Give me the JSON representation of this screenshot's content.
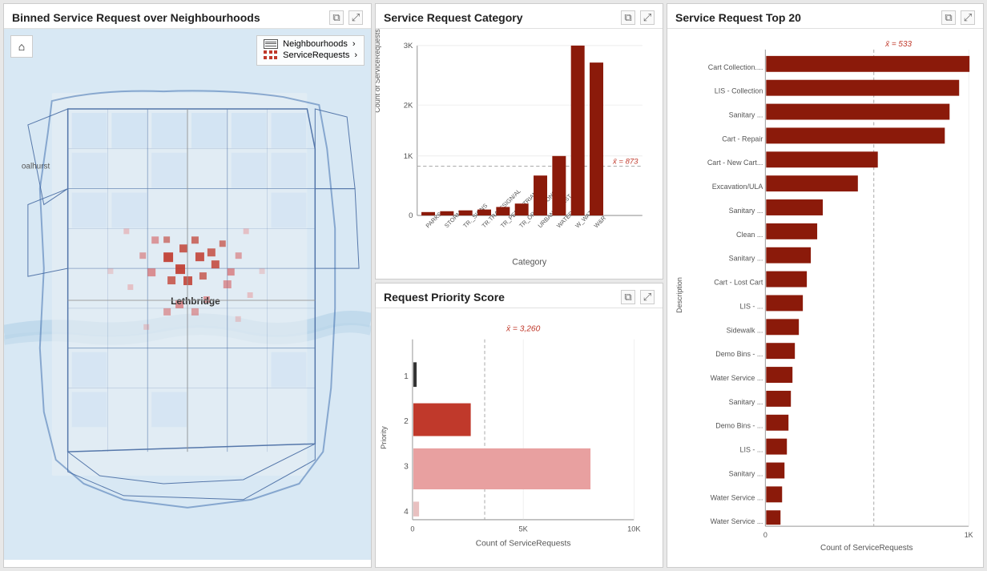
{
  "panels": {
    "map": {
      "title": "Binned Service Request over Neighbourhoods",
      "legend": {
        "neighbourhoods": "Neighbourhoods",
        "service_requests": "ServiceRequests"
      },
      "location_label": "Lethbridge",
      "north_label": "oalhurst"
    },
    "category": {
      "title": "Service Request Category",
      "y_axis_label": "Count of ServiceRequests",
      "x_axis_label": "Category",
      "mean_label": "x̄ = 873",
      "y_ticks": [
        "3K",
        "2K",
        "1K",
        "0"
      ],
      "bars": [
        {
          "label": "PARKS",
          "value": 60,
          "height_pct": 2
        },
        {
          "label": "STORM",
          "value": 80,
          "height_pct": 2.5
        },
        {
          "label": "TR._SIGNS",
          "value": 100,
          "height_pct": 3
        },
        {
          "label": "TR.TRAFF/SIGN/AL",
          "value": 110,
          "height_pct": 3.5
        },
        {
          "label": "TR_PEDESTRIAN",
          "value": 150,
          "height_pct": 5
        },
        {
          "label": "TR_OPERATIONS",
          "value": 200,
          "height_pct": 6.5
        },
        {
          "label": "URBAN_CONST",
          "value": 700,
          "height_pct": 23
        },
        {
          "label": "WATER",
          "value": 1050,
          "height_pct": 35
        },
        {
          "label": "W_WATER",
          "value": 3000,
          "height_pct": 100
        },
        {
          "label": "W&R",
          "value": 2700,
          "height_pct": 90
        }
      ]
    },
    "priority": {
      "title": "Request Priority Score",
      "y_axis_label": "Priority",
      "x_axis_label": "Count of ServiceRequests",
      "mean_label": "x̄ = 3,260",
      "mean_pct": 32,
      "x_ticks": [
        "0",
        "5K",
        "10K"
      ],
      "bars": [
        {
          "label": "1",
          "value": 50,
          "width_pct": 1,
          "color": "#333333"
        },
        {
          "label": "2",
          "value": 2000,
          "width_pct": 20,
          "color": "#c0392b"
        },
        {
          "label": "3",
          "value": 8000,
          "width_pct": 80,
          "color": "#e8a0a0"
        },
        {
          "label": "4",
          "value": 200,
          "width_pct": 2,
          "color": "#e8c0c0"
        }
      ]
    },
    "top20": {
      "title": "Service Request Top 20",
      "y_axis_label": "Description",
      "x_axis_label": "Count of ServiceRequests",
      "mean_label": "x̄ = 533",
      "mean_pct": 53,
      "x_ticks": [
        "0",
        "1K"
      ],
      "bars": [
        {
          "label": "Cart Collection....",
          "width_pct": 100
        },
        {
          "label": "LIS - Collection",
          "width_pct": 95
        },
        {
          "label": "Sanitary ...",
          "width_pct": 90
        },
        {
          "label": "Cart - Repair",
          "width_pct": 88
        },
        {
          "label": "Cart - New Cart...",
          "width_pct": 55
        },
        {
          "label": "Excavation/ULA",
          "width_pct": 45
        },
        {
          "label": "Sanitary ...",
          "width_pct": 28
        },
        {
          "label": "Clean ...",
          "width_pct": 25
        },
        {
          "label": "Sanitary ...",
          "width_pct": 22
        },
        {
          "label": "Cart - Lost Cart",
          "width_pct": 20
        },
        {
          "label": "LIS - ...",
          "width_pct": 18
        },
        {
          "label": "Sidewalk ...",
          "width_pct": 16
        },
        {
          "label": "Demo Bins - ...",
          "width_pct": 14
        },
        {
          "label": "Water Service ...",
          "width_pct": 13
        },
        {
          "label": "Sanitary ...",
          "width_pct": 12
        },
        {
          "label": "Demo Bins - ...",
          "width_pct": 11
        },
        {
          "label": "LIS - ...",
          "width_pct": 10
        },
        {
          "label": "Sanitary ...",
          "width_pct": 9
        },
        {
          "label": "Water Service ...",
          "width_pct": 8
        },
        {
          "label": "Water Service ...",
          "width_pct": 7
        }
      ]
    }
  },
  "icons": {
    "copy": "⧉",
    "expand": "⤢",
    "home": "⌂",
    "arrow_right": "›"
  }
}
